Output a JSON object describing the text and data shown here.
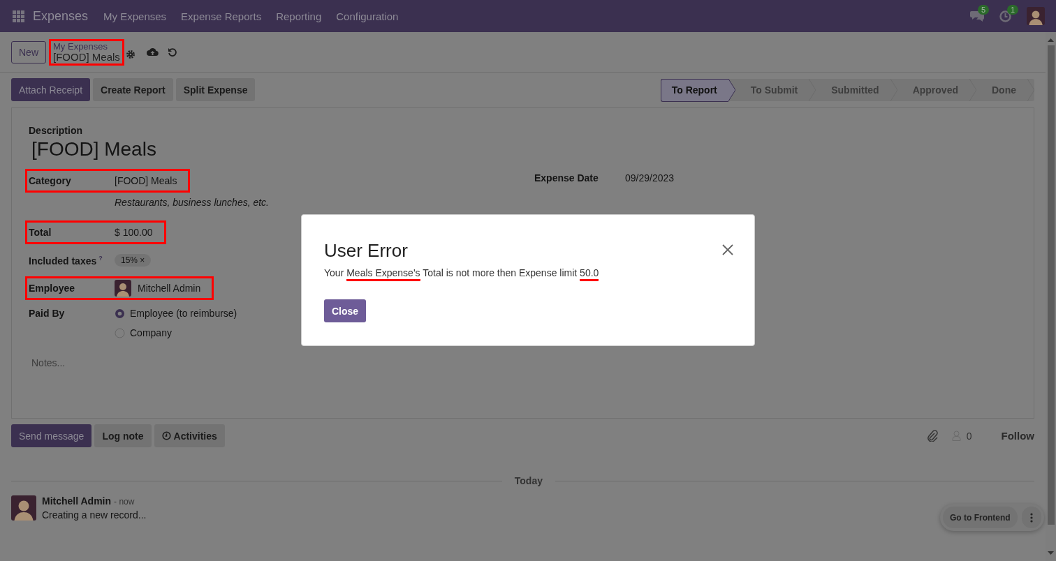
{
  "navbar": {
    "app_name": "Expenses",
    "menu": [
      "My Expenses",
      "Expense Reports",
      "Reporting",
      "Configuration"
    ],
    "messages_count": "5",
    "activities_count": "1"
  },
  "control_panel": {
    "new_button": "New",
    "breadcrumb": {
      "parent": "My Expenses",
      "current": "[FOOD] Meals",
      "highlighted": true
    }
  },
  "action_buttons": [
    {
      "label": "Attach Receipt",
      "primary": true
    },
    {
      "label": "Create Report",
      "primary": false
    },
    {
      "label": "Split Expense",
      "primary": false
    }
  ],
  "status_steps": [
    {
      "label": "To Report",
      "selected": true
    },
    {
      "label": "To Submit",
      "selected": false
    },
    {
      "label": "Submitted",
      "selected": false
    },
    {
      "label": "Approved",
      "selected": false
    },
    {
      "label": "Done",
      "selected": false
    }
  ],
  "form": {
    "description_label": "Description",
    "description": "[FOOD] Meals",
    "fields": [
      {
        "kind": "text",
        "label": "Category",
        "value": "[FOOD] Meals",
        "highlighted": true,
        "help": "Restaurants, business lunches, etc."
      },
      {
        "kind": "text",
        "label": "Total",
        "value": "$ 100.00",
        "highlighted": true
      },
      {
        "kind": "tags",
        "label": "Included taxes",
        "tooltip_mark": "?",
        "highlighted": false,
        "tags": [
          {
            "label": "15%",
            "remove_mark": "×"
          }
        ]
      },
      {
        "kind": "avatar",
        "label": "Employee",
        "value": "Mitchell Admin",
        "highlighted": true
      },
      {
        "kind": "radio",
        "label": "Paid By",
        "highlighted": false,
        "options": [
          {
            "label": "Employee (to reimburse)",
            "selected": true
          },
          {
            "label": "Company",
            "selected": false
          }
        ]
      }
    ],
    "right_fields": [
      {
        "label": "Expense Date",
        "value": "09/29/2023"
      }
    ],
    "notes_placeholder": "Notes..."
  },
  "chatter": {
    "buttons": [
      {
        "label": "Send message",
        "primary": true,
        "icon": false
      },
      {
        "label": "Log note",
        "primary": false,
        "icon": false
      },
      {
        "label": "Activities",
        "primary": false,
        "icon": true
      }
    ],
    "followers_count": "0",
    "follow": "Follow",
    "date_separator": "Today",
    "messages": [
      {
        "author": "Mitchell Admin",
        "time": "- now",
        "body": "Creating a new record..."
      }
    ]
  },
  "frontend_button": "Go to Frontend",
  "dialog": {
    "title": "User Error",
    "message": [
      {
        "text": "Your ",
        "underlined": false
      },
      {
        "text": "Meals Expense's",
        "underlined": true
      },
      {
        "text": " Total is not more then Expense limit ",
        "underlined": false
      },
      {
        "text": "50.0",
        "underlined": true
      }
    ],
    "close_button": "Close"
  }
}
